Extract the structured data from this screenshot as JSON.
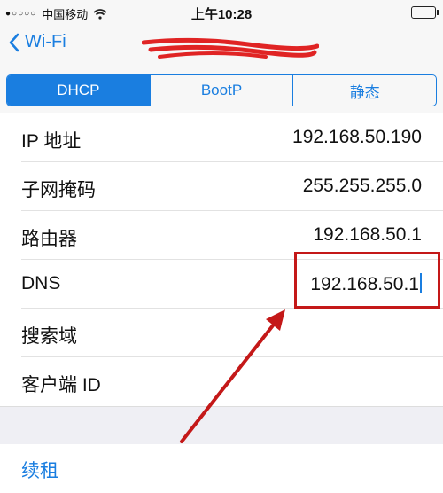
{
  "status_bar": {
    "carrier": "中国移动",
    "time": "上午10:28",
    "signal_icon": "signal-dots-icon",
    "wifi_icon": "wifi-icon"
  },
  "nav": {
    "back_label": "Wi-Fi",
    "back_icon": "chevron-left-icon"
  },
  "tabs": [
    {
      "label": "DHCP",
      "active": true
    },
    {
      "label": "BootP",
      "active": false
    },
    {
      "label": "静态",
      "active": false
    }
  ],
  "rows": [
    {
      "label": "IP 地址",
      "value": "192.168.50.190"
    },
    {
      "label": "子网掩码",
      "value": "255.255.255.0"
    },
    {
      "label": "路由器",
      "value": "192.168.50.1"
    },
    {
      "label": "DNS",
      "value": "192.168.50.1"
    },
    {
      "label": "搜索域",
      "value": ""
    },
    {
      "label": "客户端 ID",
      "value": ""
    }
  ],
  "renew": {
    "label": "续租"
  },
  "colors": {
    "accent": "#1a7ee0",
    "annotation": "#c41818",
    "background": "#ffffff",
    "separator_area": "#efeff4"
  }
}
